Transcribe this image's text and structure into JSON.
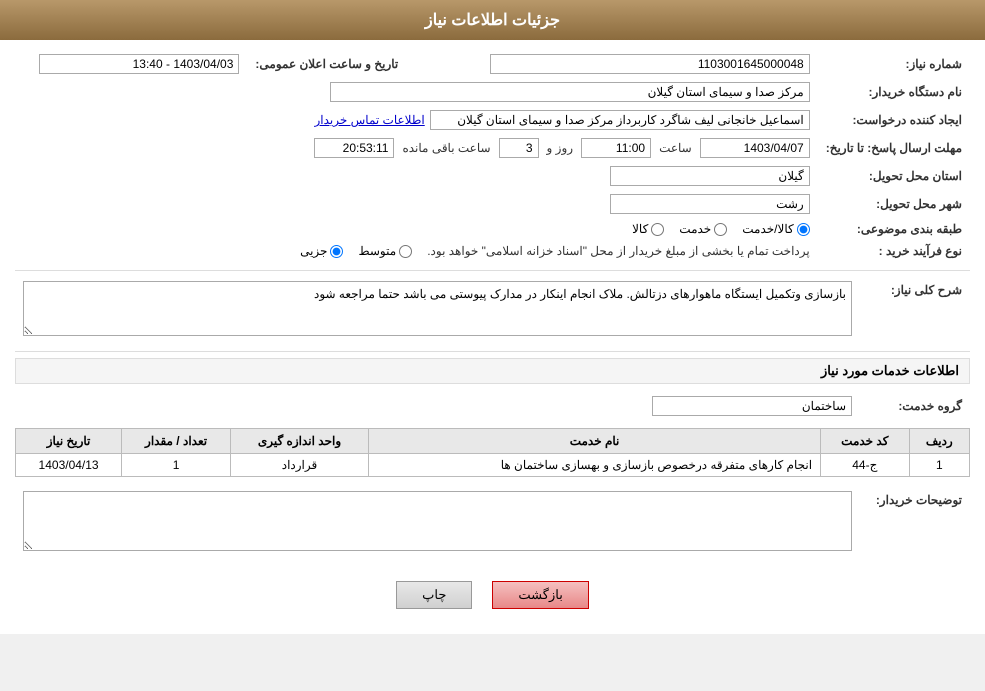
{
  "header": {
    "title": "جزئیات اطلاعات نیاز"
  },
  "fields": {
    "need_number_label": "شماره نیاز:",
    "need_number_value": "1103001645000048",
    "buyer_org_label": "نام دستگاه خریدار:",
    "buyer_org_value": "مرکز صدا و سیمای استان گیلان",
    "requester_label": "ایجاد کننده درخواست:",
    "requester_name": "اسماعیل خانجانی لیف شاگرد کاربرداز مرکز صدا و سیمای استان گیلان",
    "requester_contact_link": "اطلاعات تماس خریدار",
    "announcement_date_label": "تاریخ و ساعت اعلان عمومی:",
    "announcement_date_value": "1403/04/03 - 13:40",
    "reply_deadline_label": "مهلت ارسال پاسخ: تا تاریخ:",
    "reply_date": "1403/04/07",
    "reply_time_label": "ساعت",
    "reply_time": "11:00",
    "reply_days_label": "روز و",
    "reply_days": "3",
    "reply_remaining_label": "ساعت باقی مانده",
    "reply_remaining": "20:53:11",
    "province_label": "استان محل تحویل:",
    "province_value": "گیلان",
    "city_label": "شهر محل تحویل:",
    "city_value": "رشت",
    "category_label": "طبقه بندی موضوعی:",
    "category_kala": "کالا",
    "category_khadamat": "خدمت",
    "category_kala_khadamat": "کالا/خدمت",
    "category_selected": "kala_khadamat",
    "purchase_type_label": "نوع فرآیند خرید :",
    "purchase_jozii": "جزیی",
    "purchase_motovaset": "متوسط",
    "purchase_note": "پرداخت تمام یا بخشی از مبلغ خریدار از محل \"اسناد خزانه اسلامی\" خواهد بود.",
    "description_label": "شرح کلی نیاز:",
    "description_value": "بازسازی وتکمیل ایستگاه ماهوارهای دزتالش. ملاک انجام اینکار در مدارک پیوستی می باشد حتما مراجعه شود",
    "services_title": "اطلاعات خدمات مورد نیاز",
    "service_group_label": "گروه خدمت:",
    "service_group_value": "ساختمان",
    "table_headers": {
      "row_num": "ردیف",
      "service_code": "کد خدمت",
      "service_name": "نام خدمت",
      "unit": "واحد اندازه گیری",
      "quantity": "تعداد / مقدار",
      "date": "تاریخ نیاز"
    },
    "table_rows": [
      {
        "row_num": "1",
        "service_code": "ج-44",
        "service_name": "انجام کارهای متفرقه درخصوص بازسازی و بهسازی ساختمان ها",
        "unit": "قرارداد",
        "quantity": "1",
        "date": "1403/04/13"
      }
    ],
    "buyer_notes_label": "توضیحات خریدار:",
    "buyer_notes_value": "",
    "btn_print": "چاپ",
    "btn_back": "بازگشت"
  }
}
